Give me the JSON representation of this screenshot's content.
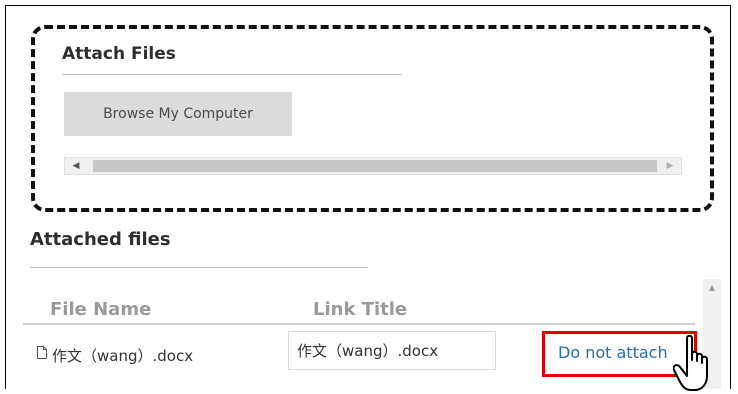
{
  "attach_section": {
    "title": "Attach Files",
    "browse_button": "Browse My Computer"
  },
  "attached_section": {
    "title": "Attached files",
    "columns": [
      "File Name",
      "Link Title"
    ],
    "rows": [
      {
        "file_name": "作文（wang）.docx",
        "link_title_value": "作文（wang）.docx",
        "action_label": "Do not attach"
      }
    ]
  },
  "icons": {
    "file": "document-icon",
    "cursor": "hand-pointer-cursor-icon",
    "scroll_left": "arrow-left-icon",
    "scroll_right": "arrow-right-icon",
    "scroll_up": "arrow-up-icon"
  },
  "colors": {
    "highlight": "#e00000",
    "link": "#2e6ca4",
    "button_bg": "#dcdcdc"
  }
}
